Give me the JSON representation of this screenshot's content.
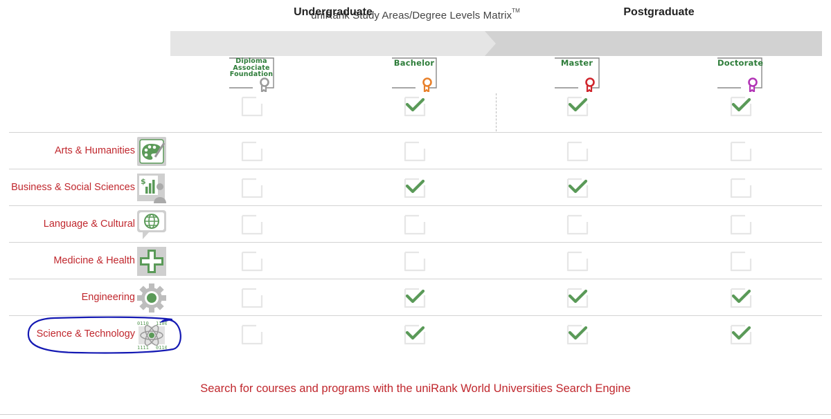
{
  "title": {
    "text": "uniRank Study Areas/Degree Levels Matrix",
    "tm": "TM"
  },
  "bands": {
    "undergraduate": "Undergraduate",
    "postgraduate": "Postgraduate"
  },
  "degrees": [
    {
      "key": "diploma",
      "lines": [
        "Diploma",
        "Associate",
        "Foundation"
      ],
      "ribbon_color": "#9a9a9a",
      "available": false
    },
    {
      "key": "bachelor",
      "lines": [
        "Bachelor"
      ],
      "ribbon_color": "#e8812b",
      "available": true
    },
    {
      "key": "master",
      "lines": [
        "Master"
      ],
      "ribbon_color": "#d0252c",
      "available": true
    },
    {
      "key": "doctorate",
      "lines": [
        "Doctorate"
      ],
      "ribbon_color": "#b234b6",
      "available": true
    }
  ],
  "rows": [
    {
      "label": "Arts & Humanities",
      "icon": "palette-icon",
      "checks": [
        false,
        false,
        false,
        false
      ]
    },
    {
      "label": "Business & Social Sciences",
      "icon": "business-chart-icon",
      "checks": [
        false,
        true,
        true,
        false
      ]
    },
    {
      "label": "Language & Cultural",
      "icon": "globe-speech-icon",
      "checks": [
        false,
        false,
        false,
        false
      ]
    },
    {
      "label": "Medicine & Health",
      "icon": "medical-cross-icon",
      "checks": [
        false,
        false,
        false,
        false
      ]
    },
    {
      "label": "Engineering",
      "icon": "gear-icon",
      "checks": [
        false,
        true,
        true,
        true
      ]
    },
    {
      "label": "Science & Technology",
      "icon": "atom-binary-icon",
      "checks": [
        false,
        true,
        true,
        true
      ]
    }
  ],
  "footer_link": "Search for courses and programs with the uniRank World Universities Search Engine",
  "colors": {
    "accent_red": "#c0272d",
    "check_green": "#5a9a58",
    "icon_green": "#5a9a58",
    "annotation_blue": "#1419b3"
  }
}
